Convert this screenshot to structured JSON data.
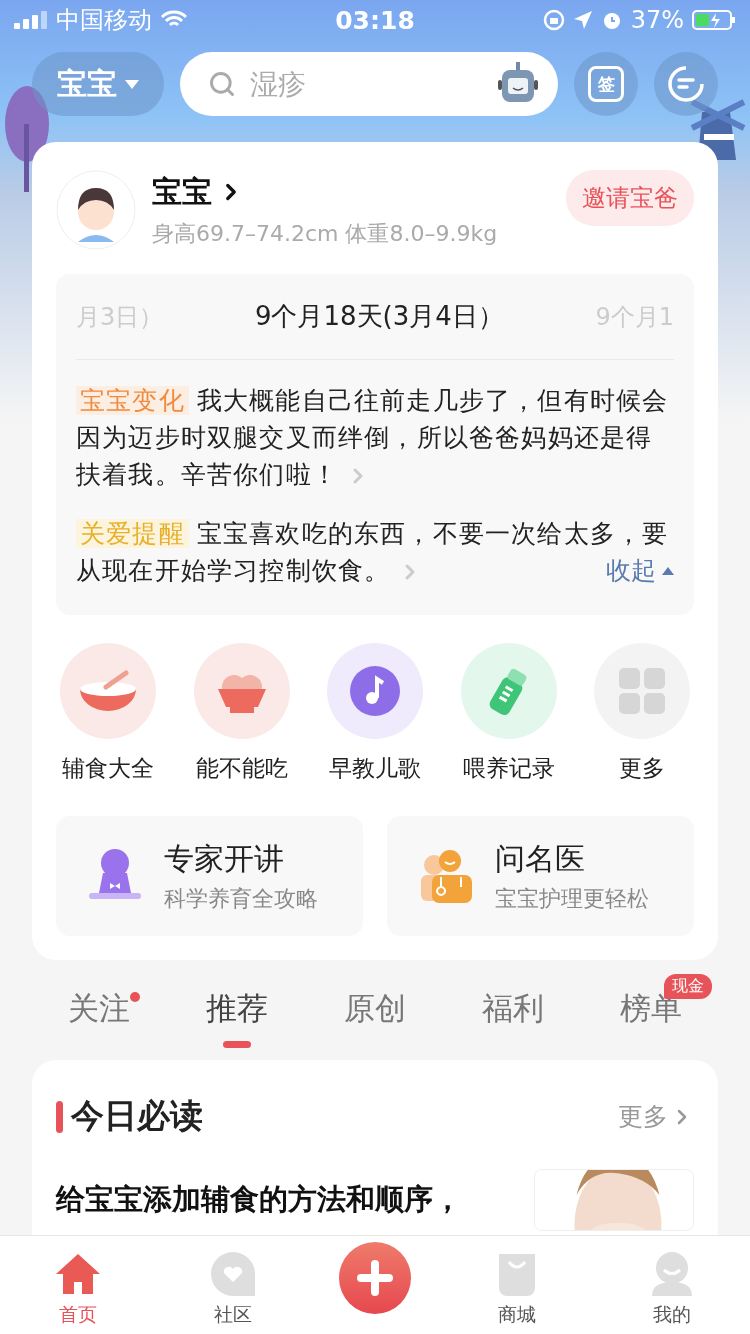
{
  "status_bar": {
    "carrier": "中国移动",
    "time": "03:18",
    "battery": "37%"
  },
  "header": {
    "baby_selector": "宝宝",
    "search": {
      "placeholder": "湿疹"
    },
    "sign_in_label": "签"
  },
  "profile": {
    "name": "宝宝",
    "measurements": "身高69.7–74.2cm 体重8.0–9.9kg",
    "invite_button": "邀请宝爸"
  },
  "timeline": {
    "dates": [
      {
        "label": "月3日）",
        "selected": false
      },
      {
        "label": "9个月18天(3月4日）",
        "selected": true
      },
      {
        "label": "9个月1",
        "selected": false
      }
    ],
    "tips": [
      {
        "kind": "change",
        "tag": "宝宝变化",
        "text": "我大概能自己往前走几步了，但有时候会因为迈步时双腿交叉而绊倒，所以爸爸妈妈还是得扶着我。辛苦你们啦！"
      },
      {
        "kind": "care",
        "tag": "关爱提醒",
        "text": "宝宝喜欢吃的东西，不要一次给太多，要从现在开始学习控制饮食。"
      }
    ],
    "collapse_link": "收起"
  },
  "shortcuts": [
    {
      "kind": "bowl",
      "label": "辅食大全"
    },
    {
      "kind": "rice",
      "label": "能不能吃"
    },
    {
      "kind": "music",
      "label": "早教儿歌"
    },
    {
      "kind": "bottle",
      "label": "喂养记录"
    },
    {
      "kind": "grid",
      "label": "更多"
    }
  ],
  "features": [
    {
      "kind": "expert",
      "title": "专家开讲",
      "subtitle": "科学养育全攻略"
    },
    {
      "kind": "doctor",
      "title": "问名医",
      "subtitle": "宝宝护理更轻松"
    }
  ],
  "feed_tabs": [
    {
      "label": "关注",
      "selected": false,
      "dot": true
    },
    {
      "label": "推荐",
      "selected": true,
      "dot": false
    },
    {
      "label": "原创",
      "selected": false,
      "dot": false
    },
    {
      "label": "福利",
      "selected": false,
      "dot": false
    },
    {
      "label": "榜单",
      "selected": false,
      "dot": false,
      "badge": "现金"
    }
  ],
  "daily_read": {
    "title": "今日必读",
    "more_link": "更多",
    "article": {
      "title": "给宝宝添加辅食的方法和顺序，"
    }
  },
  "bottom_nav": [
    {
      "kind": "home",
      "label": "首页",
      "selected": true
    },
    {
      "kind": "community",
      "label": "社区",
      "selected": false
    },
    {
      "kind": "add",
      "selected": false
    },
    {
      "kind": "shop",
      "label": "商城",
      "selected": false
    },
    {
      "kind": "profile",
      "label": "我的",
      "selected": false
    }
  ]
}
